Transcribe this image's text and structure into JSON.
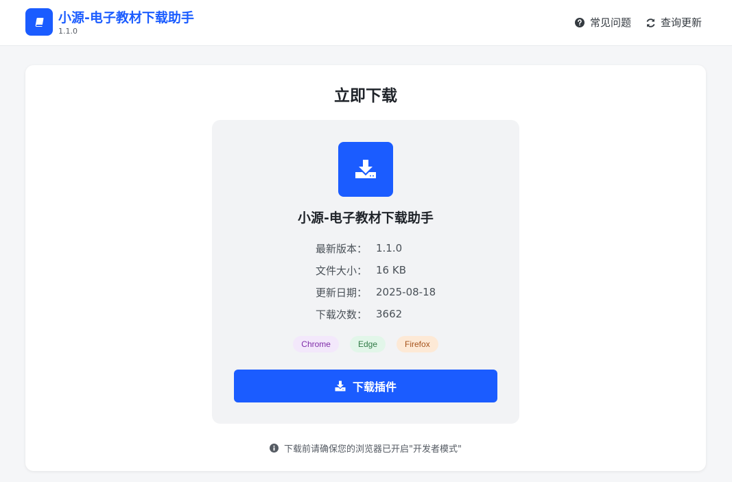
{
  "header": {
    "app_title": "小源-电子教材下载助手",
    "app_version": "1.1.0",
    "nav": {
      "faq_label": "常见问题",
      "update_label": "查询更新"
    }
  },
  "main": {
    "title": "立即下载",
    "product": {
      "name": "小源-电子教材下载助手",
      "info": [
        {
          "label": "最新版本：",
          "value": "1.1.0"
        },
        {
          "label": "文件大小：",
          "value": "16 KB"
        },
        {
          "label": "更新日期：",
          "value": "2025-08-18"
        },
        {
          "label": "下载次数：",
          "value": "3662"
        }
      ],
      "browsers": [
        "Chrome",
        "Edge",
        "Firefox"
      ]
    },
    "download_button_label": "下载插件",
    "note": "下载前请确保您的浏览器已开启\"开发者模式\""
  },
  "icons": {
    "logo": "book-icon",
    "faq": "question-circle-icon",
    "update": "refresh-icon",
    "download_box": "download-tray-icon",
    "download_button": "download-icon",
    "note": "info-circle-icon"
  },
  "colors": {
    "accent": "#1b5cff",
    "chrome_tag_bg": "#f3e8fb",
    "edge_tag_bg": "#e2f6e9",
    "firefox_tag_bg": "#fde9d6"
  }
}
